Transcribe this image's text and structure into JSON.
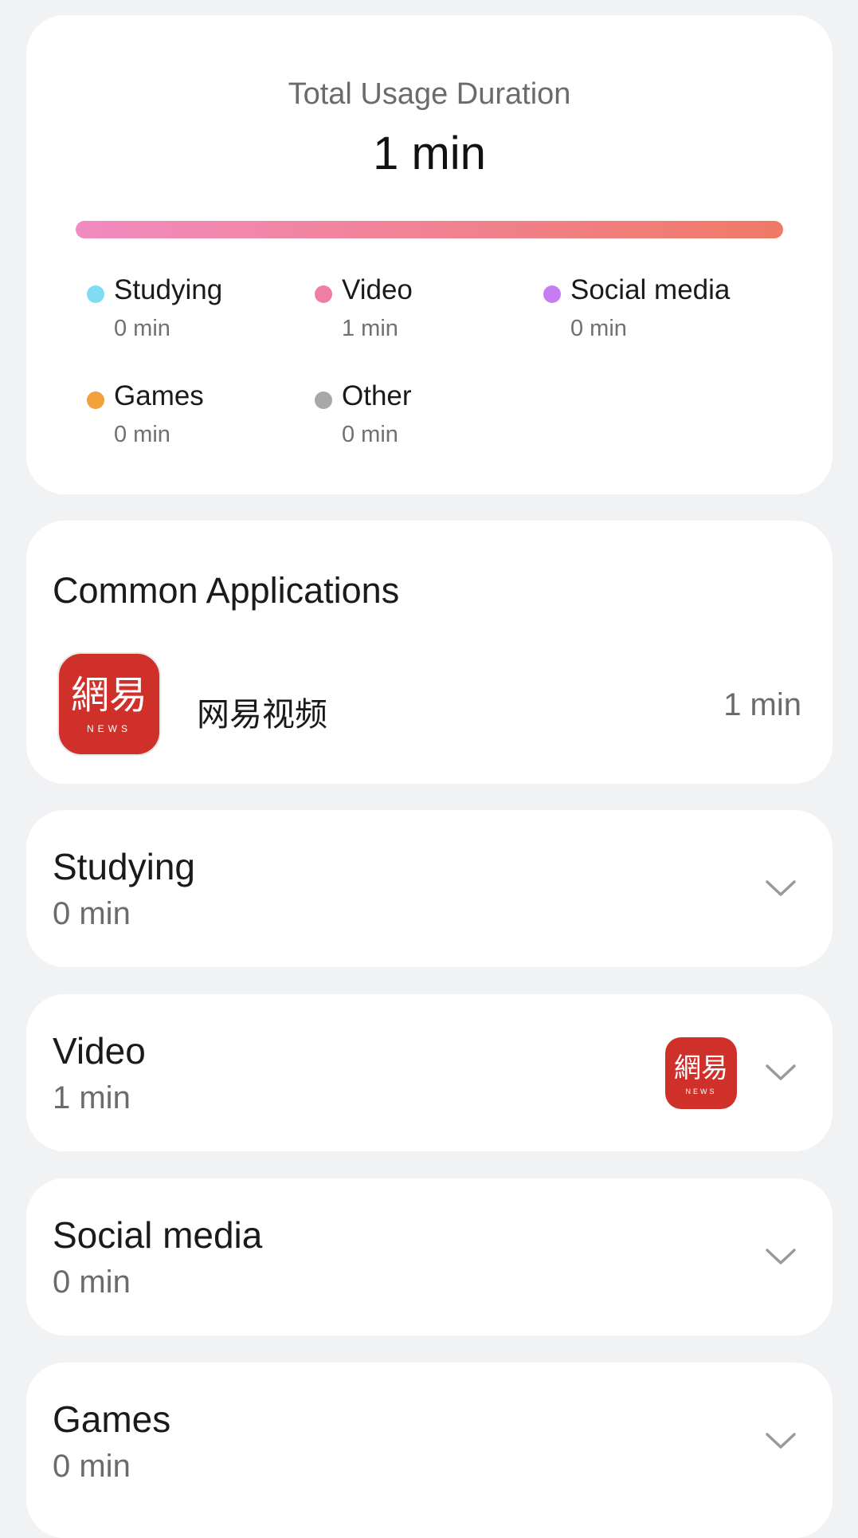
{
  "summary": {
    "title": "Total Usage Duration",
    "total": "1 min",
    "bar_gradient": [
      "#f18bc0",
      "#f07a66"
    ],
    "legend": [
      {
        "label": "Studying",
        "value": "0 min",
        "color": "#7fdcf3"
      },
      {
        "label": "Video",
        "value": "1 min",
        "color": "#ee7fa3"
      },
      {
        "label": "Social media",
        "value": "0 min",
        "color": "#c77df2"
      },
      {
        "label": "Games",
        "value": "0 min",
        "color": "#f2a03a"
      },
      {
        "label": "Other",
        "value": "0 min",
        "color": "#a8a8a8"
      }
    ]
  },
  "common": {
    "title": "Common Applications",
    "apps": [
      {
        "name": "网易视频",
        "time": "1 min",
        "icon": "netease-news-icon",
        "icon_text": "網易",
        "icon_subtext": "NEWS"
      }
    ]
  },
  "categories": [
    {
      "name": "Studying",
      "time": "0 min"
    },
    {
      "name": "Video",
      "time": "1 min",
      "app_icon": "netease-news-icon"
    },
    {
      "name": "Social media",
      "time": "0 min"
    },
    {
      "name": "Games",
      "time": "0 min"
    }
  ]
}
